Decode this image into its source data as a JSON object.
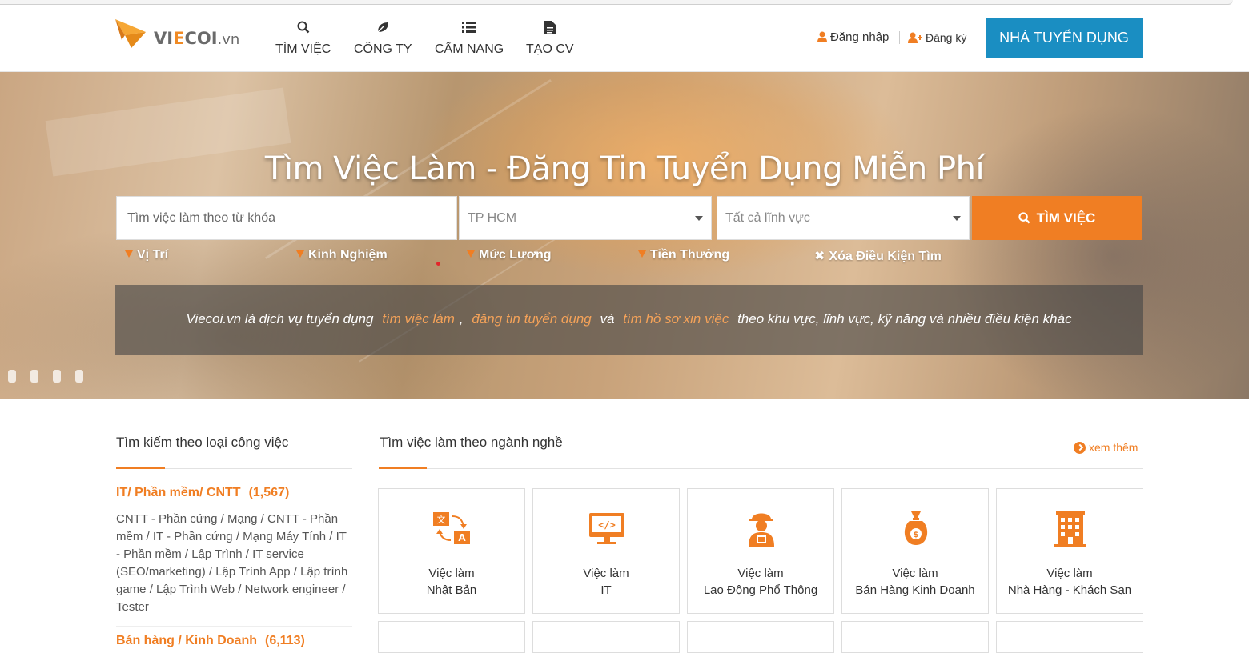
{
  "header": {
    "logo_text": "VIECOI.vn",
    "nav": [
      {
        "label": "TÌM VIỆC",
        "icon": "search-icon"
      },
      {
        "label": "CÔNG TY",
        "icon": "leaf-icon"
      },
      {
        "label": "CẨM NANG",
        "icon": "list-icon"
      },
      {
        "label": "TẠO CV",
        "icon": "document-icon"
      }
    ],
    "login_label": "Đăng nhập",
    "register_label": "Đăng ký",
    "employer_button": "NHÀ TUYỂN DỤNG"
  },
  "hero": {
    "title": "Tìm Việc Làm  -  Đăng Tin Tuyển Dụng Miễn Phí",
    "search_placeholder": "Tìm việc làm theo từ khóa",
    "location_value": "TP HCM",
    "field_value": "Tất cả lĩnh vực",
    "search_button": "TÌM VIỆC",
    "filters": [
      "Vị Trí",
      "Kinh Nghiệm",
      "Mức Lương",
      "Tiền Thưởng"
    ],
    "clear_filters": "Xóa Điều Kiện Tìm",
    "desc_prefix": "Viecoi.vn là dịch vụ tuyển dụng",
    "desc_link1": "tìm việc làm",
    "desc_comma": ",",
    "desc_link2": "đăng tin tuyển dụng",
    "desc_and": "và",
    "desc_link3": "tìm hồ sơ xin việc",
    "desc_suffix": "theo khu vực, lĩnh vực, kỹ năng và nhiều điều kiện khác"
  },
  "left": {
    "title": "Tìm kiếm theo loại công việc",
    "categories": [
      {
        "name": "IT/ Phần mềm/ CNTT",
        "count": "(1,567)",
        "desc": "CNTT - Phần cứng / Mạng / CNTT - Phần mềm / IT - Phần cứng / Mạng Máy Tính / IT - Phần mềm / Lập Trình / IT service (SEO/marketing) / Lập Trình App / Lập trình game / Lập Trình Web / Network engineer / Tester"
      },
      {
        "name": "Bán hàng / Kinh Doanh",
        "count": "(6,113)"
      }
    ]
  },
  "right": {
    "title": "Tìm việc làm theo ngành nghề",
    "see_more": "xem thêm",
    "cards": [
      {
        "line1": "Việc làm",
        "line2": "Nhật Bản",
        "icon": "translate-icon"
      },
      {
        "line1": "Việc làm",
        "line2": "IT",
        "icon": "code-monitor-icon"
      },
      {
        "line1": "Việc làm",
        "line2": "Lao Động Phổ Thông",
        "icon": "worker-icon"
      },
      {
        "line1": "Việc làm",
        "line2": "Bán Hàng Kinh Doanh",
        "icon": "money-bag-icon"
      },
      {
        "line1": "Việc làm",
        "line2": "Nhà Hàng - Khách Sạn",
        "icon": "hotel-icon"
      }
    ]
  },
  "colors": {
    "accent": "#f07e23",
    "primary": "#1a8ec2"
  }
}
